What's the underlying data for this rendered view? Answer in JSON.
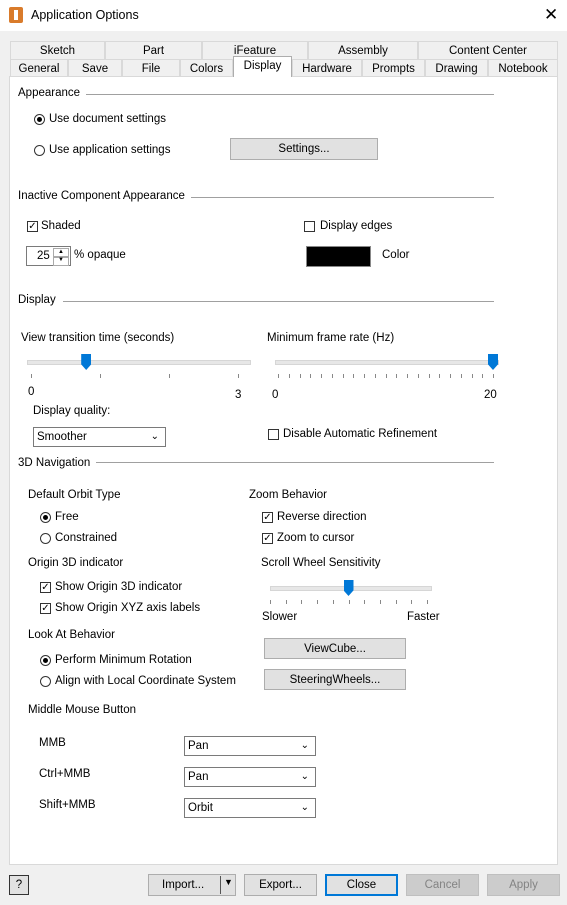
{
  "window": {
    "title": "Application Options",
    "close_glyph": "✕"
  },
  "tabs_row1": [
    "Sketch",
    "Part",
    "iFeature",
    "Assembly",
    "Content Center"
  ],
  "tabs_row2": [
    "General",
    "Save",
    "File",
    "Colors",
    "Display",
    "Hardware",
    "Prompts",
    "Drawing",
    "Notebook"
  ],
  "active_tab": "Display",
  "appearance": {
    "title": "Appearance",
    "use_document": "Use document settings",
    "use_application": "Use application settings",
    "selected": "document",
    "settings_button": "Settings..."
  },
  "inactive": {
    "title": "Inactive Component Appearance",
    "shaded_label": "Shaded",
    "shaded": true,
    "opacity_value": "25",
    "opacity_label": "% opaque",
    "display_edges_label": "Display edges",
    "display_edges": false,
    "color_label": "Color",
    "color_swatch": "#000000"
  },
  "display": {
    "title": "Display",
    "view_transition_label": "View transition time (seconds)",
    "view_transition_min": "0",
    "view_transition_max": "3",
    "view_transition_value": 0.8,
    "min_frame_rate_label": "Minimum frame rate (Hz)",
    "min_frame_rate_min": "0",
    "min_frame_rate_max": "20",
    "min_frame_rate_value": 20,
    "quality_label": "Display quality:",
    "quality_value": "Smoother",
    "disable_refinement_label": "Disable Automatic Refinement",
    "disable_refinement": false
  },
  "nav": {
    "title": "3D Navigation",
    "orbit_title": "Default Orbit Type",
    "orbit_free": "Free",
    "orbit_constrained": "Constrained",
    "orbit_selected": "free",
    "zoom_title": "Zoom Behavior",
    "reverse_label": "Reverse direction",
    "reverse": true,
    "zoom_cursor_label": "Zoom to cursor",
    "zoom_cursor": true,
    "origin_title": "Origin 3D indicator",
    "show_origin_label": "Show Origin 3D indicator",
    "show_origin": true,
    "show_xyz_label": "Show Origin XYZ axis labels",
    "show_xyz": true,
    "scroll_title": "Scroll Wheel Sensitivity",
    "scroll_slower": "Slower",
    "scroll_faster": "Faster",
    "scroll_value": 0.5,
    "lookat_title": "Look At Behavior",
    "lookat_min": "Perform Minimum Rotation",
    "lookat_align": "Align with Local Coordinate System",
    "lookat_selected": "min",
    "viewcube_button": "ViewCube...",
    "steering_button": "SteeringWheels...",
    "mmb_title": "Middle Mouse Button",
    "mmb_label": "MMB",
    "mmb_value": "Pan",
    "ctrl_label": "Ctrl+MMB",
    "ctrl_value": "Pan",
    "shift_label": "Shift+MMB",
    "shift_value": "Orbit"
  },
  "footer": {
    "help": "?",
    "import": "Import...",
    "export": "Export...",
    "close": "Close",
    "cancel": "Cancel",
    "apply": "Apply"
  }
}
